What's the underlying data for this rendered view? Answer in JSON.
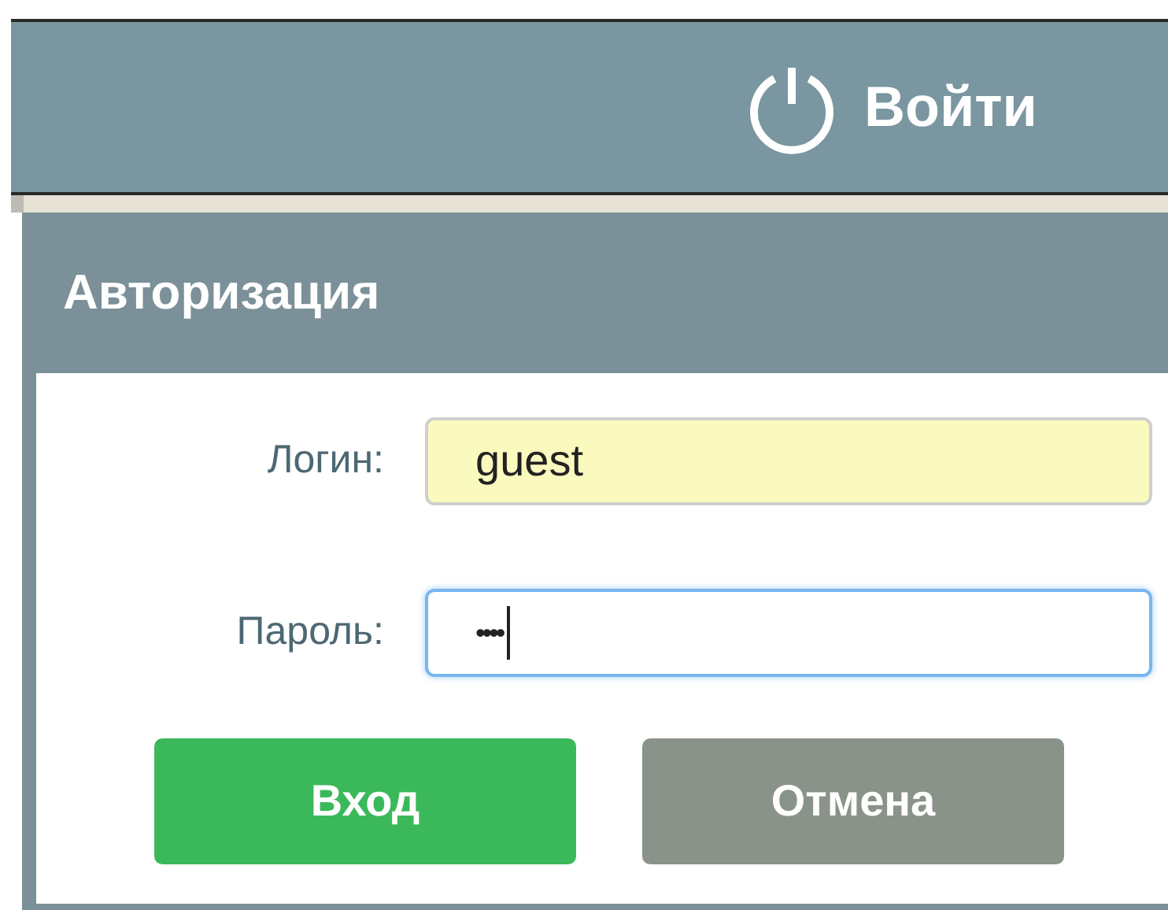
{
  "top_bar": {
    "login_link": "Войти"
  },
  "dialog": {
    "title": "Авторизация",
    "fields": [
      {
        "label": "Логин:",
        "value": "guest",
        "autofilled": true,
        "focused": false
      },
      {
        "label": "Пароль:",
        "value": "••••",
        "autofilled": false,
        "focused": true
      }
    ],
    "buttons": [
      {
        "label": "Вход",
        "kind": "primary"
      },
      {
        "label": "Отмена",
        "kind": "secondary"
      }
    ]
  }
}
